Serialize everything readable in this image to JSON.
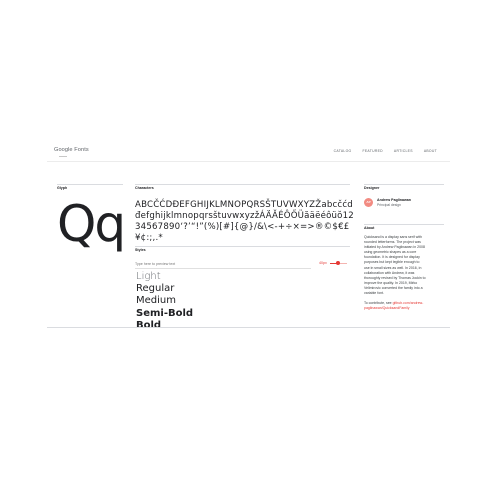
{
  "header": {
    "brand": "Google Fonts",
    "nav": [
      "CATALOG",
      "FEATURED",
      "ARTICLES",
      "ABOUT"
    ]
  },
  "glyph": {
    "label": "Glyph",
    "sample": "Qq"
  },
  "characters": {
    "label": "Characters",
    "text": "ABCČĆDĐEFGHIJKLMNOPQRSŠTUVWXYZŽabcčćdđefghijklmnopqrsštuvwxyzžÁÄĂÉÔŐÜăäëéôüŏ1234567890‘?’“!”(%)[#]{@}/&\\<-+÷×=>®©$€£¥¢:;,.*"
  },
  "styles": {
    "label": "Styles",
    "placeholder": "Type here to preview text",
    "size_label": "40px",
    "slider_value": 0.4,
    "items": [
      "Light",
      "Regular",
      "Medium",
      "Semi-Bold",
      "Bold"
    ]
  },
  "designer": {
    "label": "Designer",
    "avatar_initials": "AP",
    "name": "Andrew Paglinawan",
    "role": "Principal design"
  },
  "about": {
    "label": "About",
    "paragraph1": "Quicksand is a display sans serif with rounded letterforms. The project was initiated by Andrew Paglinawan in 2008 using geometric shapes as a core foundation. It is designed for display purposes but kept legible enough to use in small sizes as well. In 2016, in collaboration with Andrew, it was thoroughly revised by Thomas Jockin to improve the quality. In 2019, Mirko Velimirovic converted the family into a variable font.",
    "contribute_prefix": "To contribute, see ",
    "contribute_link": "github.com/andrew-paglinawan/QuicksandFamily"
  },
  "colors": {
    "accent": "#e53935",
    "avatar": "#f28b82",
    "divider": "#dadce0"
  }
}
